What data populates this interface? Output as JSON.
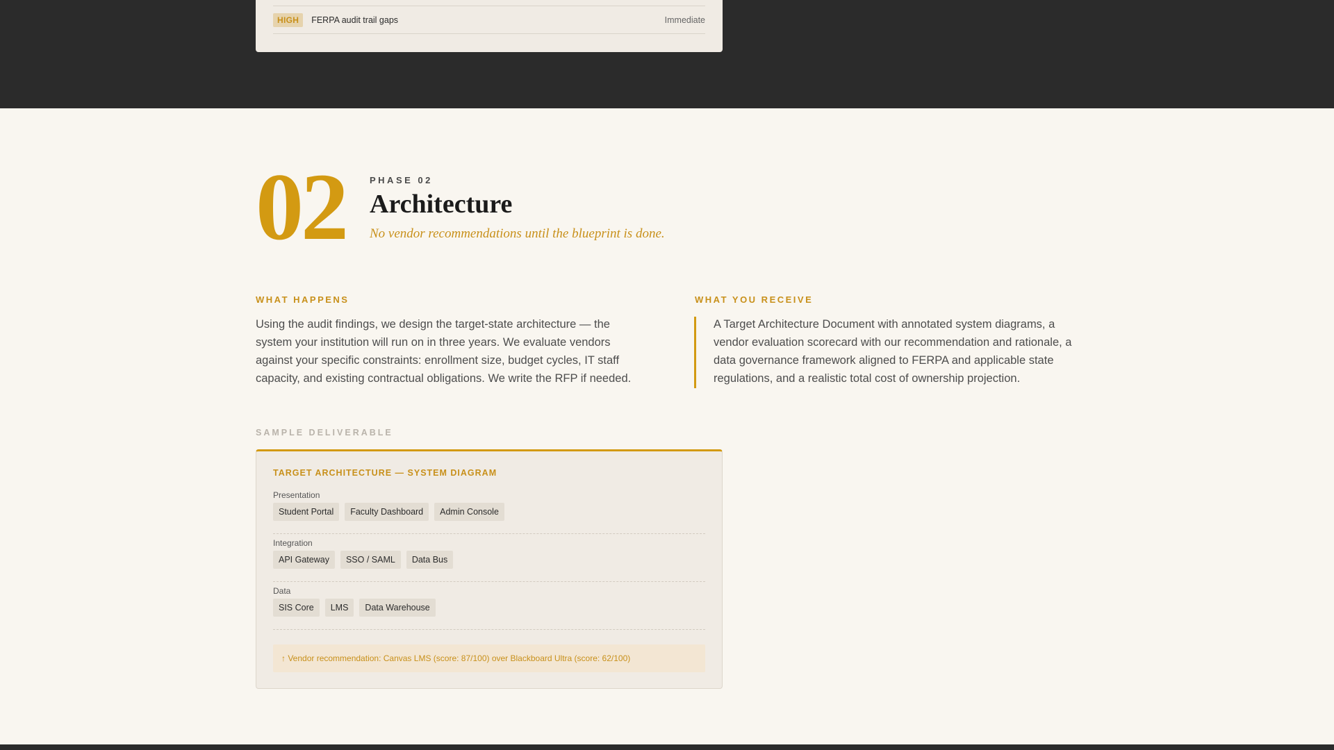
{
  "audit": {
    "row": {
      "severity": "HIGH",
      "finding": "FERPA audit trail gaps",
      "timing": "Immediate"
    }
  },
  "phase": {
    "number": "02",
    "label": "PHASE 02",
    "title": "Architecture",
    "tagline": "No vendor recommendations until the blueprint is done."
  },
  "what_happens": {
    "heading": "WHAT HAPPENS",
    "body": "Using the audit findings, we design the target-state architecture — the system your institution will run on in three years. We evaluate vendors against your specific constraints: enrollment size, budget cycles, IT staff capacity, and existing contractual obligations. We write the RFP if needed."
  },
  "what_you_receive": {
    "heading": "WHAT YOU RECEIVE",
    "body": "A Target Architecture Document with annotated system diagrams, a vendor evaluation scorecard with our recommendation and rationale, a data governance framework aligned to FERPA and applicable state regulations, and a realistic total cost of ownership projection."
  },
  "sample": {
    "label": "SAMPLE DELIVERABLE",
    "title": "TARGET ARCHITECTURE — SYSTEM DIAGRAM",
    "layers": [
      {
        "name": "Presentation",
        "items": [
          "Student Portal",
          "Faculty Dashboard",
          "Admin Console"
        ]
      },
      {
        "name": "Integration",
        "items": [
          "API Gateway",
          "SSO / SAML",
          "Data Bus"
        ]
      },
      {
        "name": "Data",
        "items": [
          "SIS Core",
          "LMS",
          "Data Warehouse"
        ]
      }
    ],
    "vendor_note": "↑ Vendor recommendation: Canvas LMS (score: 87/100) over Blackboard Ultra (score: 62/100)"
  },
  "colors": {
    "accent": "#d39a12",
    "dark": "#2b2b2b",
    "background": "#f9f6f0",
    "card": "#f0ebe4"
  }
}
